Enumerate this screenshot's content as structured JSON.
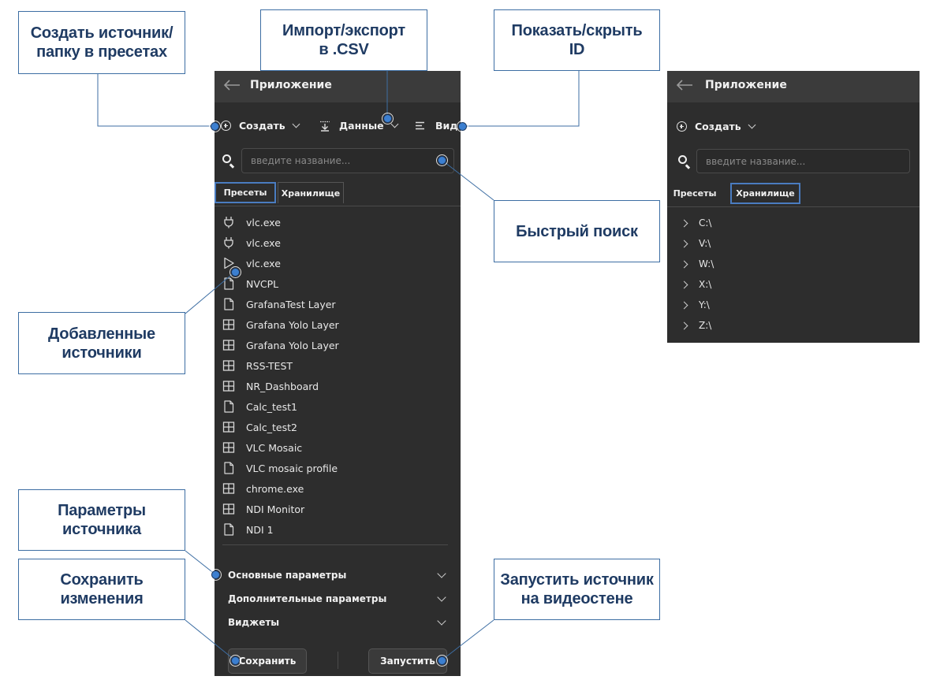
{
  "callouts": {
    "create": "Создать источник/\nпапку в пресетах",
    "import_export": "Импорт/экспорт\nв .CSV",
    "show_hide": "Показать/скрыть\nID",
    "quick_search": "Быстрый поиск",
    "added_sources": "Добавленные\nисточники",
    "source_params": "Параметры\nисточника",
    "save_changes": "Сохранить\nизменения",
    "run_source": "Запустить источник\nна видеостене"
  },
  "left_panel": {
    "title": "Приложение",
    "toolbar": {
      "create_label": "Создать",
      "data_label": "Данные",
      "view_label": "Вид"
    },
    "search": {
      "placeholder": "введите название..."
    },
    "tabs": [
      "Пресеты",
      "Хранилище"
    ],
    "selected_tab": "Пресеты",
    "items": [
      {
        "icon": "plug-icon",
        "label": "vlc.exe"
      },
      {
        "icon": "plug-icon",
        "label": "vlc.exe"
      },
      {
        "icon": "play-icon",
        "label": "vlc.exe"
      },
      {
        "icon": "file-icon",
        "label": "NVCPL"
      },
      {
        "icon": "file-icon",
        "label": "GrafanaTest Layer"
      },
      {
        "icon": "grid-icon",
        "label": "Grafana Yolo Layer"
      },
      {
        "icon": "grid-icon",
        "label": "Grafana Yolo Layer"
      },
      {
        "icon": "grid-icon",
        "label": "RSS-TEST"
      },
      {
        "icon": "grid-icon",
        "label": "NR_Dashboard"
      },
      {
        "icon": "file-icon",
        "label": "Calc_test1"
      },
      {
        "icon": "grid-icon",
        "label": "Calc_test2"
      },
      {
        "icon": "grid-icon",
        "label": "VLC Mosaic"
      },
      {
        "icon": "file-icon",
        "label": "VLC mosaic profile"
      },
      {
        "icon": "grid-icon",
        "label": "chrome.exe"
      },
      {
        "icon": "grid-icon",
        "label": "NDI Monitor"
      },
      {
        "icon": "file-icon",
        "label": "NDI 1"
      }
    ],
    "sections": [
      "Основные параметры",
      "Дополнительные параметры",
      "Виджеты"
    ],
    "buttons": {
      "save": "Сохранить",
      "run": "Запустить"
    }
  },
  "right_panel": {
    "title": "Приложение",
    "toolbar": {
      "create_label": "Создать"
    },
    "search": {
      "placeholder": "введите название..."
    },
    "tabs": [
      "Пресеты",
      "Хранилище"
    ],
    "selected_tab": "Хранилище",
    "drives": [
      "C:\\",
      "V:\\",
      "W:\\",
      "X:\\",
      "Y:\\",
      "Z:\\"
    ]
  },
  "colors": {
    "panel_bg": "#2d2d2d",
    "titlebar_bg": "#3b3b3b",
    "accent": "#4a7cc0",
    "callout_text": "#1f3b63",
    "callout_border": "#3d6ea3"
  }
}
